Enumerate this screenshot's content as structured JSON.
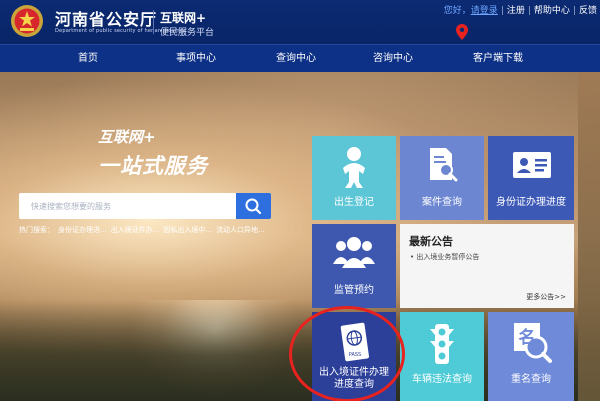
{
  "header": {
    "site_title": "河南省公安厅",
    "site_subtitle_en": "Department of public security of henan province",
    "brand": "互联网+",
    "brand_sub": "便民服务平台",
    "top_links": {
      "greeting": "您好，",
      "login": "请登录",
      "register": "注册",
      "help": "帮助中心",
      "feedback": "反馈"
    }
  },
  "nav": {
    "items": [
      {
        "label": "首页"
      },
      {
        "label": "事项中心"
      },
      {
        "label": "查询中心"
      },
      {
        "label": "咨询中心"
      },
      {
        "label": "客户端下载"
      }
    ]
  },
  "hero": {
    "slogan_line1": "互联网+",
    "slogan_line2": "一站式服务",
    "search": {
      "placeholder": "快速搜索您想要的服务"
    },
    "hot_search": {
      "label": "热门搜索：",
      "items": [
        "身份证办理进...",
        "出入境证件办...",
        "因私出入境中...",
        "流动人口异地..."
      ]
    }
  },
  "tiles": {
    "birth": {
      "label": "出生登记",
      "icon": "baby-icon"
    },
    "case": {
      "label": "案件查询",
      "icon": "document-search-icon"
    },
    "id_card": {
      "label": "身份证办理进度",
      "icon": "id-card-icon"
    },
    "supervision": {
      "label": "监管预约",
      "icon": "group-icon"
    },
    "passport": {
      "label_line1": "出入境证件办理",
      "label_line2": "进度查询",
      "icon": "passport-icon",
      "badge": "PASS"
    },
    "traffic": {
      "label": "车辆违法查询",
      "icon": "traffic-light-icon"
    },
    "name": {
      "label": "重名查询",
      "icon": "name-search-icon",
      "glyph": "名"
    }
  },
  "notice": {
    "title": "最新公告",
    "items": [
      "出入境业务暂停公告"
    ],
    "more": "更多公告>>"
  },
  "colors": {
    "header_bg": "#0b2a72",
    "nav_bg": "#0d3186",
    "search_btn": "#2e6fe0",
    "highlight_circle": "#e8221f"
  }
}
